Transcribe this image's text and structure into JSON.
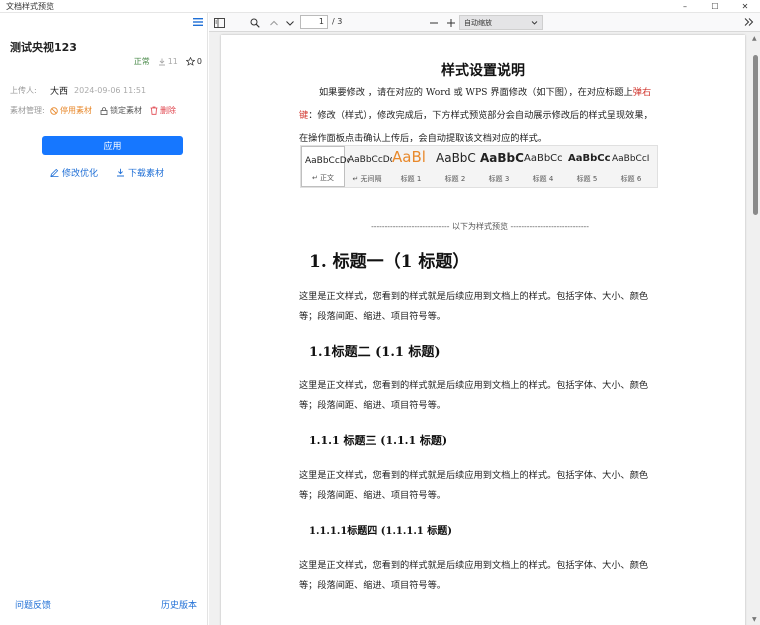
{
  "window": {
    "title": "文档样式预览"
  },
  "left": {
    "doc_name": "测试央视123",
    "status": "正常",
    "downloads": "11",
    "stars": "0",
    "uploader_label": "上传人:",
    "uploader_name": "大西",
    "upload_date": "2024-09-06 11:51",
    "manage_label": "素材管理:",
    "disable_label": "停用素材",
    "lock_label": "锁定素材",
    "delete_label": "删除",
    "apply_label": "应用",
    "edit_label": "修改优化",
    "download_label": "下载素材",
    "feedback_label": "问题反馈",
    "history_label": "历史版本"
  },
  "toolbar": {
    "page_current": "1",
    "page_total": "/ 3",
    "zoom_label": "自动缩放"
  },
  "page": {
    "title": "样式设置说明",
    "intro_part1": "如果要修改 ，请在对应的 Word 或 WPS 界面修改（如下图），在对应标题上",
    "intro_red": "弹右键",
    "intro_part2": "：修改（样式），修改完成后，下方样式预览部分会自动展示修改后的样式呈现效果，在操作面板点击确认上传后，会自动提取该文档对应的样式。",
    "ribbon": [
      {
        "sample": "AaBbCcDc",
        "label": "↵ 正文"
      },
      {
        "sample": "AaBbCcDc",
        "label": "↵ 无间隔"
      },
      {
        "sample": "AaBl",
        "label": "标题 1"
      },
      {
        "sample": "AaBbC",
        "label": "标题 2"
      },
      {
        "sample": "AaBbC",
        "label": "标题 3"
      },
      {
        "sample": "AaBbCc",
        "label": "标题 4"
      },
      {
        "sample": "AaBbCc",
        "label": "标题 5"
      },
      {
        "sample": "AaBbCcI",
        "label": "标题 6"
      }
    ],
    "divider": "----------------------------- 以下为样式预览 -----------------------------",
    "h1": "1.  标题一（1  标题）",
    "h2": "1.1标题二    (1.1  标题)",
    "h3": "1.1.1  标题三    (1.1.1  标题)",
    "h4": "1.1.1.1标题四    (1.1.1.1  标题)",
    "body": "这里是正文样式，您看到的样式就是后续应用到文档上的样式。包括字体、大小、颜色等；段落间距、缩进、项目符号等。"
  },
  "colors": {
    "accent": "#1677ff",
    "link": "#1f6fd6",
    "warn": "#e8892c",
    "danger": "#e0424b",
    "highlight_red": "#d0342c"
  }
}
